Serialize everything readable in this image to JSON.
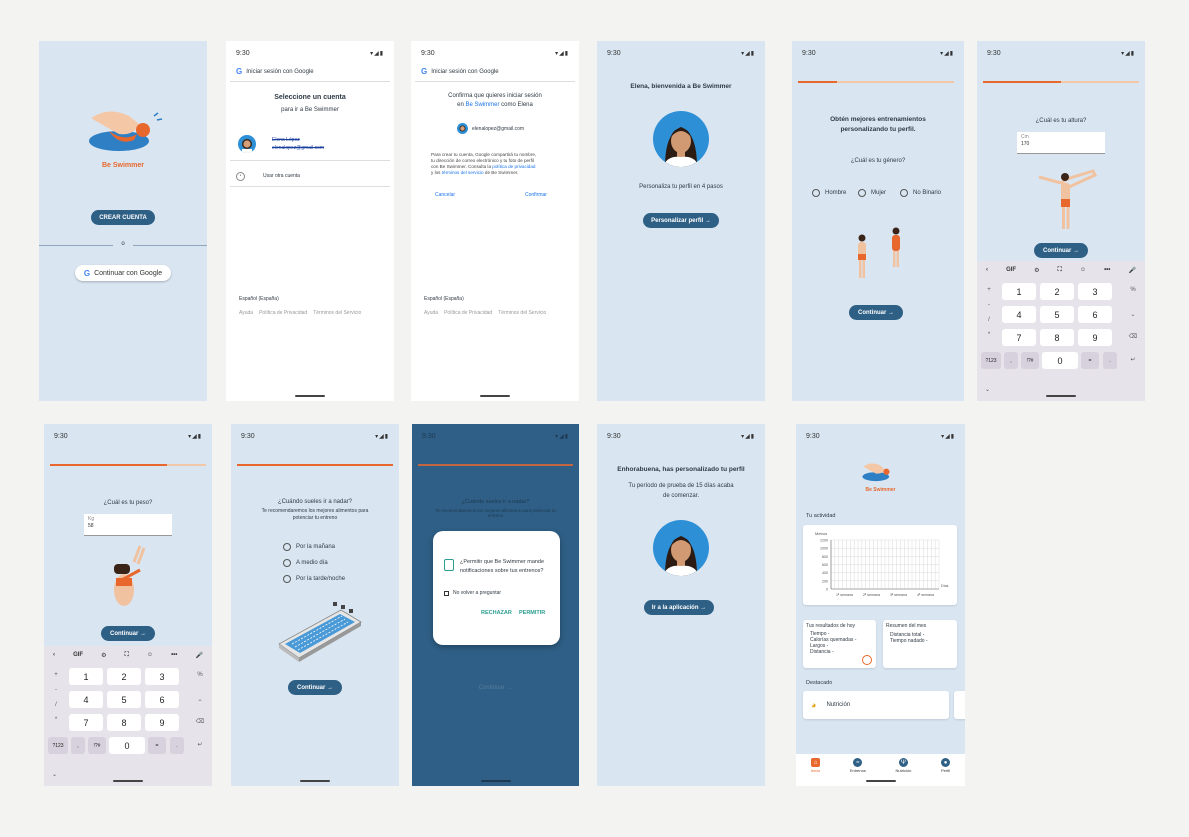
{
  "status": {
    "time": "9:30",
    "icons": "▾◢▮"
  },
  "s1": {
    "brand": "Be Swimmer",
    "create": "CREAR CUENTA",
    "or": "o",
    "google": "Continuar con Google"
  },
  "s2": {
    "header": "Iniciar sesión con Google",
    "title": "Seleccione un cuenta",
    "subtitle": "para ir a Be Swimmer",
    "account_name": "Elena López",
    "account_email": "elenalopez@gmail.com",
    "other": "Usar otra cuenta",
    "lang": "Español (España)",
    "footer": [
      "Ayuda",
      "Política de Privacidad",
      "Términos del Servicio"
    ]
  },
  "s3": {
    "header": "Iniciar sesión con Google",
    "title1": "Confirma que quieres iniciar sesión",
    "title2_pre": "en",
    "title2_link": "Be Swimmer",
    "title2_post": "como Elena",
    "email": "elenalopez@gmail.com",
    "body1": "Para crear tu cuenta, Google compartirá tu nombre,",
    "body2": "tu dirección de correo electrónico y tu foto de perfil",
    "body3_pre": "con Be Swimmer. Consulta la",
    "body3_link": "política de privacidad",
    "body4_pre": "y los",
    "body4_link": "términos del servicio",
    "body4_post": "de Be Swimmer.",
    "cancel": "Cancelar",
    "confirm": "Confirmar",
    "lang": "Español (España)",
    "footer": [
      "Ayuda",
      "Política de Privacidad",
      "Términos del Servicio"
    ]
  },
  "s4": {
    "welcome": "Elena, bienvenida a Be Swimmer",
    "text": "Personaliza tu perfil en 4 pasos",
    "button": "Personalizar perfil"
  },
  "s5": {
    "progress": 0.25,
    "title1": "Obtén mejores entrenamientos",
    "title2": "personalizando tu perfil.",
    "question": "¿Cuál es tu género?",
    "options": [
      "Hombre",
      "Mujer",
      "No Binario"
    ],
    "button": "Continuar"
  },
  "s6": {
    "progress": 0.5,
    "question": "¿Cuál es tu altura?",
    "unit": "Cm",
    "value": "170",
    "button": "Continuar"
  },
  "keyboard": {
    "top": [
      "‹",
      "GIF",
      "⚙",
      "⛶",
      "☺",
      "•••",
      "🎤"
    ],
    "rows": [
      [
        "1",
        "2",
        "3"
      ],
      [
        "4",
        "5",
        "6"
      ],
      [
        "7",
        "8",
        "9"
      ]
    ],
    "bottom": [
      "?123",
      ",",
      "!?#",
      "0",
      "=",
      "."
    ],
    "left": [
      "+",
      "-",
      "/",
      "*"
    ],
    "right": [
      "%",
      "⎵",
      "⌫",
      "↵"
    ]
  },
  "s7": {
    "progress": 0.75,
    "question": "¿Cuál es tu peso?",
    "unit": "Kg",
    "value": "58",
    "button": "Continuar"
  },
  "s8": {
    "progress": 1,
    "question": "¿Cuándo sueles ir a nadar?",
    "sub1": "Te recomendaremos los mejores alimentos para",
    "sub2": "potenciar tu entreno",
    "options": [
      "Por la mañana",
      "A medio día",
      "Por la tarde/noche"
    ],
    "button": "Continuar"
  },
  "s9": {
    "bg_question": "¿Cuándo sueles ir a nadar?",
    "bg_sub": "Te recomendaremos los mejores alimentos para potenciar tu entreno",
    "dialog_title1": "¿Permitir que Be Swimmer mande",
    "dialog_title2": "notificaciones sobre tus entrenos?",
    "checkbox": "No volver a preguntar",
    "reject": "RECHAZAR",
    "allow": "PERMITIR",
    "button": "Continuar"
  },
  "s10": {
    "title": "Enhorabuena, has personalizado tu perfil",
    "sub1": "Tu período de prueba de 15 días acaba",
    "sub2": "de comenzar.",
    "button": "Ir a la aplicación"
  },
  "s11": {
    "brand": "Be Swimmer",
    "activity": "Tu actividad",
    "results_title": "Tus resultados de hoy",
    "results": [
      "Tiempo -",
      "Calorías quemadas -",
      "Largos -",
      "Distancia -"
    ],
    "summary_title": "Resumen del mes",
    "summary": [
      "Distancia total -",
      "Tiempo nadado -"
    ],
    "featured": "Destacado",
    "nutrition": "Nutrición",
    "nav": [
      "Inicio",
      "Entrenos",
      "Nutrición",
      "Perfil"
    ]
  },
  "chart_data": {
    "type": "line",
    "categories": [
      "1ª semana",
      "2ª semana",
      "3ª semana",
      "4ª semana"
    ],
    "series": [],
    "ylabel": "Metros",
    "xlabel": "Días",
    "yticks": [
      0,
      200,
      400,
      600,
      800,
      1000,
      1200
    ],
    "ylim": [
      0,
      1200
    ],
    "grid": true
  },
  "colors": {
    "accent": "#e8672c",
    "primary": "#2e5f85",
    "bg": "#d9e6f2"
  }
}
